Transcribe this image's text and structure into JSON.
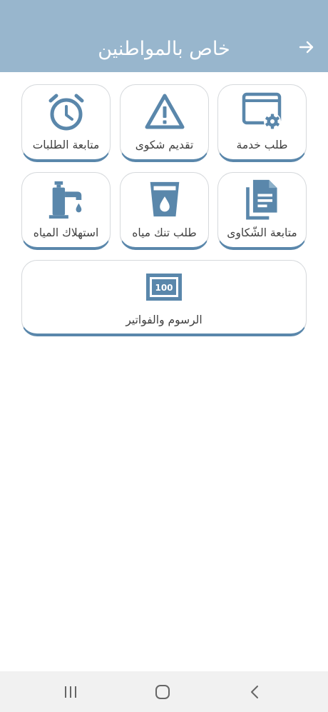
{
  "header": {
    "title": "خاص بالمواطنين",
    "back_icon": "arrow-right-icon"
  },
  "tiles": [
    {
      "label": "طلب خدمة",
      "icon": "window-gear-icon"
    },
    {
      "label": "تقديم شكوى",
      "icon": "warning-triangle-icon"
    },
    {
      "label": "متابعة الطلبات",
      "icon": "alarm-clock-icon"
    },
    {
      "label": "متابعة الشّكاوى",
      "icon": "documents-icon"
    },
    {
      "label": "طلب تنك مياه",
      "icon": "water-glass-icon"
    },
    {
      "label": "استهلاك المياه",
      "icon": "water-tap-icon"
    },
    {
      "label": "الرسوم والفواتير",
      "icon": "banknote-icon",
      "banknote_text": "100"
    }
  ],
  "nav": {
    "recent_icon": "recent-apps-icon",
    "home_icon": "home-icon",
    "back_icon": "back-chevron-icon"
  },
  "colors": {
    "header": "#98b6cd",
    "accent": "#5a87ab",
    "icon": "#5a87ab",
    "text": "#3f3f3f"
  }
}
